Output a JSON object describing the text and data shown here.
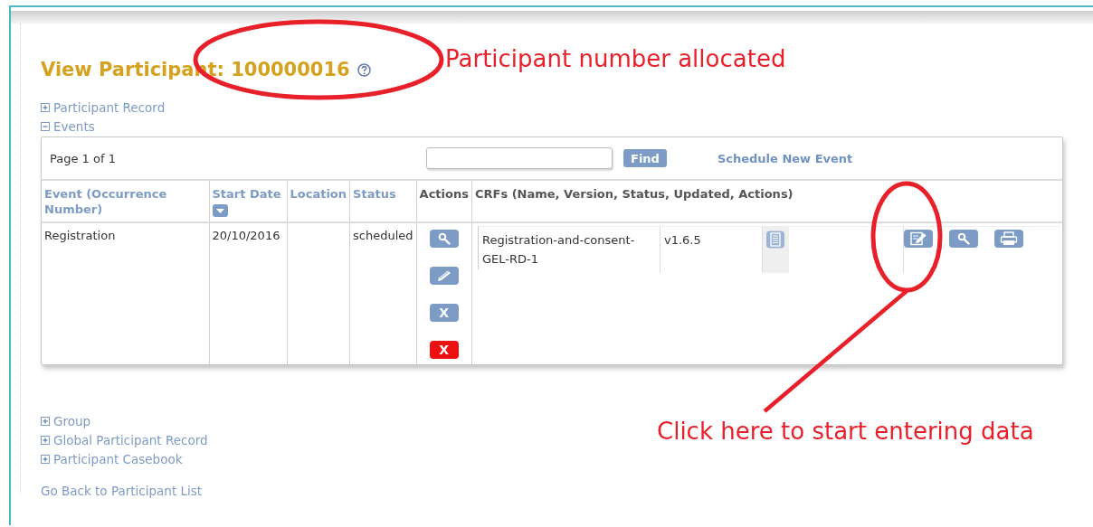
{
  "page": {
    "title": "View Participant: 100000016"
  },
  "sections_top": [
    {
      "label": "Participant Record",
      "expanded": false
    },
    {
      "label": "Events",
      "expanded": true
    }
  ],
  "events": {
    "pager": "Page 1 of 1",
    "search": {
      "button": "Find"
    },
    "schedule_link": "Schedule New Event",
    "columns": [
      {
        "label": "Event (Occurrence Number)",
        "link": true,
        "sort": false
      },
      {
        "label": "Start Date",
        "link": true,
        "sort": true
      },
      {
        "label": "Location",
        "link": true,
        "sort": false
      },
      {
        "label": "Status",
        "link": true,
        "sort": false
      },
      {
        "label": "Actions",
        "link": false,
        "sort": false
      },
      {
        "label": "CRFs (Name, Version, Status, Updated, Actions)",
        "link": false,
        "sort": false
      }
    ],
    "rows": [
      {
        "event": "Registration",
        "start_date": "20/10/2016",
        "status": "scheduled",
        "actions": [
          {
            "kind": "view"
          },
          {
            "kind": "edit"
          },
          {
            "kind": "remove",
            "label": "X"
          },
          {
            "kind": "delete",
            "label": "X"
          }
        ],
        "crfs": [
          {
            "name": "Registration-and-consent-GEL-RD-1",
            "version": "v1.6.5",
            "actions": [
              {
                "kind": "enter"
              },
              {
                "kind": "view"
              },
              {
                "kind": "print"
              }
            ]
          }
        ]
      }
    ]
  },
  "sections_bottom": [
    {
      "label": "Group",
      "expanded": false
    },
    {
      "label": "Global Participant Record",
      "expanded": false
    },
    {
      "label": "Participant Casebook",
      "expanded": false
    }
  ],
  "back_link": "Go Back to Participant List",
  "annotations": [
    {
      "kind": "number",
      "text": "Participant number allocated"
    },
    {
      "kind": "enter_data",
      "text": "Click here to start entering data"
    }
  ]
}
